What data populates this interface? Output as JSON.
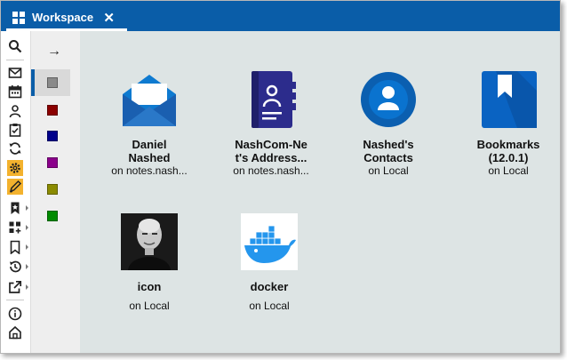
{
  "tab": {
    "label": "Workspace",
    "close": "✕"
  },
  "panel": {
    "arrow": "→",
    "colors": [
      "#8a8a8a",
      "#8b0000",
      "#00008b",
      "#8b008b",
      "#8b8b00",
      "#008b00"
    ]
  },
  "sidebar_icons": [
    "search-icon",
    "mail-icon",
    "calendar-icon",
    "contacts-icon",
    "todo-icon",
    "replication-icon",
    "settings-icon",
    "edit-icon",
    "bookmark-icon",
    "applications-icon",
    "bookmarks-icon",
    "history-icon",
    "open-icon",
    "info-icon",
    "home-icon"
  ],
  "tiles": [
    {
      "name_line1": "Daniel",
      "name_line2": "Nashed",
      "sub": "on notes.nash...",
      "icon": "mail-envelope-icon"
    },
    {
      "name_line1": "NashCom-Ne",
      "name_line2": "t's Address...",
      "sub": "on notes.nash...",
      "icon": "address-book-icon"
    },
    {
      "name_line1": "Nashed's",
      "name_line2": "Contacts",
      "sub": "on Local",
      "icon": "contacts-circle-icon"
    },
    {
      "name_line1": "Bookmarks",
      "name_line2": "(12.0.1)",
      "sub": "on Local",
      "icon": "bookmarks-icon"
    },
    {
      "name_line1": "icon",
      "name_line2": "",
      "sub": "on Local",
      "icon": "portrait-photo-icon"
    },
    {
      "name_line1": "docker",
      "name_line2": "",
      "sub": "on Local",
      "icon": "docker-whale-icon"
    }
  ]
}
